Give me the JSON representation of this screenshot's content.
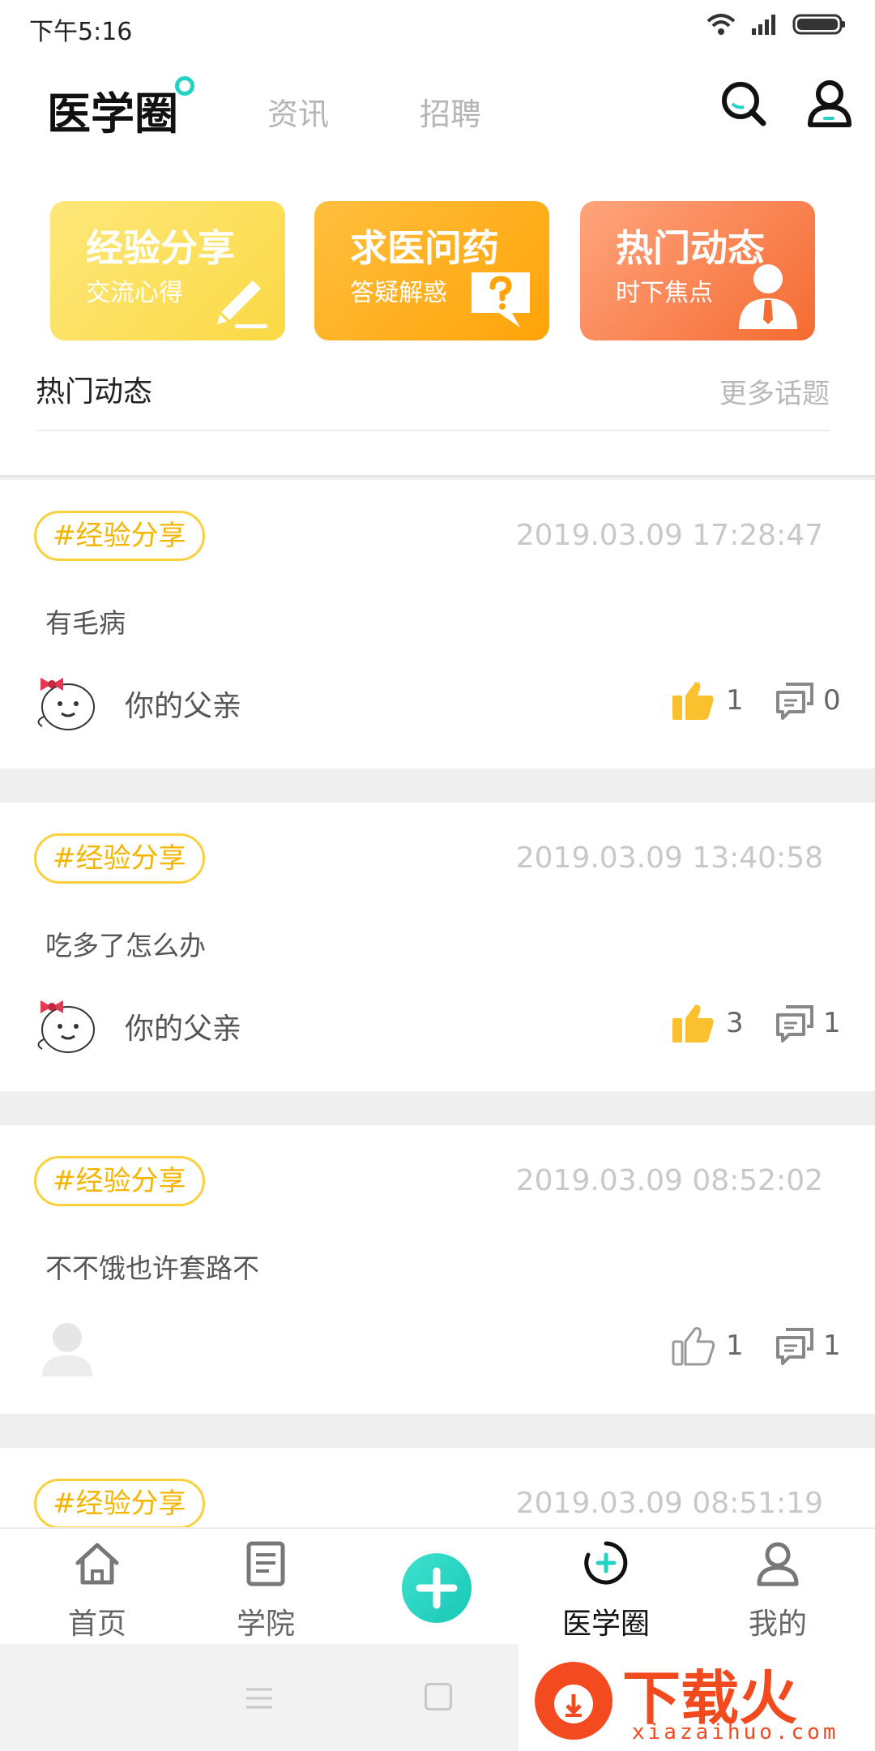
{
  "status_bar": {
    "time": "下午5:16"
  },
  "header": {
    "logo": "医学圈",
    "tabs": [
      "资讯",
      "招聘"
    ]
  },
  "categories": [
    {
      "title": "经验分享",
      "subtitle": "交流心得",
      "icon": "pencil-icon"
    },
    {
      "title": "求医问药",
      "subtitle": "答疑解惑",
      "icon": "question-bubble-icon"
    },
    {
      "title": "热门动态",
      "subtitle": "时下焦点",
      "icon": "person-tie-icon"
    }
  ],
  "section": {
    "title": "热门动态",
    "more": "更多话题"
  },
  "posts": [
    {
      "tag": "#经验分享",
      "time": "2019.03.09 17:28:47",
      "content": "有毛病",
      "author": "你的父亲",
      "likes": "1",
      "comments": "0",
      "liked": true
    },
    {
      "tag": "#经验分享",
      "time": "2019.03.09 13:40:58",
      "content": "吃多了怎么办",
      "author": "你的父亲",
      "likes": "3",
      "comments": "1",
      "liked": true
    },
    {
      "tag": "#经验分享",
      "time": "2019.03.09 08:52:02",
      "content": "不不饿也许套路不",
      "author": "",
      "likes": "1",
      "comments": "1",
      "liked": false
    },
    {
      "tag": "#经验分享",
      "time": "2019.03.09 08:51:19"
    }
  ],
  "bottom_nav": [
    {
      "label": "首页",
      "icon": "home-icon"
    },
    {
      "label": "学院",
      "icon": "book-icon"
    },
    {
      "label": "",
      "icon": "plus-icon"
    },
    {
      "label": "医学圈",
      "icon": "circle-plus-icon",
      "active": true
    },
    {
      "label": "我的",
      "icon": "user-icon"
    }
  ],
  "watermark": {
    "text": "下载火",
    "url": "xiazaihuo.com"
  },
  "colors": {
    "accent": "#22d3c5",
    "tag": "#f5b400",
    "like_active": "#fbc02d"
  }
}
